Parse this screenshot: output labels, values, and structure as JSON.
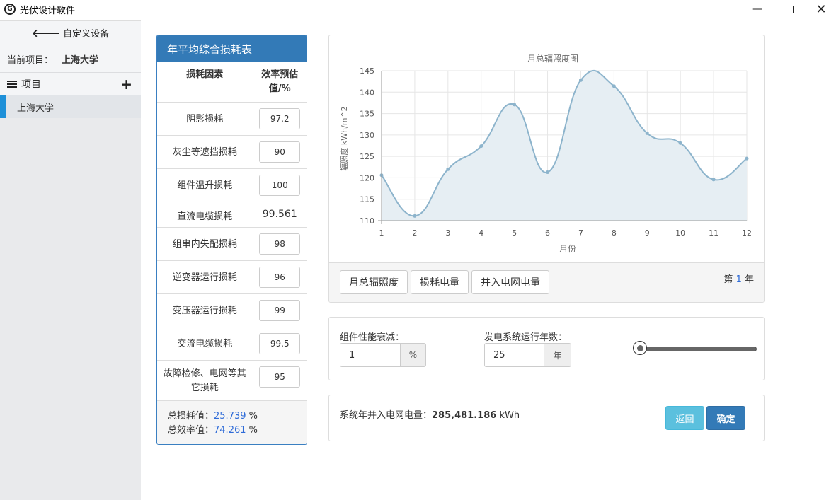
{
  "window": {
    "title": "光伏设计软件",
    "logo_text": "G"
  },
  "sidebar": {
    "back_label": "自定义设备",
    "project_prefix": "当前项目：",
    "project_name": "上海大学",
    "section_label": "项目",
    "items": [
      {
        "label": "上海大学"
      }
    ]
  },
  "loss_table": {
    "title": "年平均综合损耗表",
    "headers": [
      "损耗因素",
      "效率预估值/%"
    ],
    "rows": [
      {
        "factor": "阴影损耗",
        "value": "97.2",
        "editable": true
      },
      {
        "factor": "灰尘等遮挡损耗",
        "value": "90",
        "editable": true
      },
      {
        "factor": "组件温升损耗",
        "value": "100",
        "editable": true
      },
      {
        "factor": "直流电缆损耗",
        "value": "99.561",
        "editable": false
      },
      {
        "factor": "组串内失配损耗",
        "value": "98",
        "editable": true
      },
      {
        "factor": "逆变器运行损耗",
        "value": "96",
        "editable": true
      },
      {
        "factor": "变压器运行损耗",
        "value": "99",
        "editable": true
      },
      {
        "factor": "交流电缆损耗",
        "value": "99.5",
        "editable": true
      },
      {
        "factor": "故障检修、电网等其它损耗",
        "value": "95",
        "editable": true
      }
    ],
    "total_loss_label": "总损耗值：",
    "total_loss_value": "25.739",
    "total_eff_label": "总效率值：",
    "total_eff_value": "74.261",
    "unit": "%"
  },
  "chart_data": {
    "type": "area",
    "title": "月总辐照度图",
    "xlabel": "月份",
    "ylabel": "辐照度 kWh/m^2",
    "x": [
      1,
      2,
      3,
      4,
      5,
      6,
      7,
      8,
      9,
      10,
      11,
      12
    ],
    "values": [
      120.6,
      111.1,
      122.0,
      127.4,
      137.1,
      121.3,
      142.8,
      141.4,
      130.4,
      128.1,
      119.6,
      124.5
    ],
    "ylim": [
      110,
      145
    ],
    "yticks": [
      110,
      115,
      120,
      125,
      130,
      135,
      140,
      145
    ],
    "grid": true,
    "color": "#8db4cc",
    "fill": "#e6eef3"
  },
  "chart_tabs": [
    "月总辐照度",
    "损耗电量",
    "并入电网电量"
  ],
  "year_indicator": {
    "prefix": "第",
    "value": "1",
    "suffix": "年"
  },
  "params": {
    "degradation_label": "组件性能衰减：",
    "degradation_value": "1",
    "degradation_unit": "%",
    "years_label": "发电系统运行年数：",
    "years_value": "25",
    "years_unit": "年",
    "slider_value_fraction": 0
  },
  "result": {
    "label": "系统年并入电网电量：",
    "value": "285,481.186",
    "unit": "kWh",
    "back_label": "返回",
    "ok_label": "确定"
  },
  "colors": {
    "primary": "#337ab7",
    "info": "#5bc0de",
    "accent_blue": "#2e6bd8",
    "sidebar_marker": "#1e90d8"
  }
}
